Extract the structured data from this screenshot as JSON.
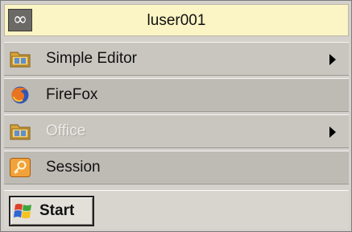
{
  "header": {
    "logo_glyph": "∞",
    "username": "luser001"
  },
  "menu": {
    "items": [
      {
        "label": "Simple Editor",
        "icon": "folder-icon",
        "has_submenu": true,
        "disabled": false
      },
      {
        "label": "FireFox",
        "icon": "firefox-icon",
        "has_submenu": false,
        "disabled": false
      },
      {
        "label": "Office",
        "icon": "folder-icon",
        "has_submenu": true,
        "disabled": true
      },
      {
        "label": "Session",
        "icon": "key-icon",
        "has_submenu": false,
        "disabled": false
      }
    ]
  },
  "taskbar": {
    "start_label": "Start",
    "start_icon": "windows-logo-icon"
  },
  "colors": {
    "header_bg": "#fbf4c4",
    "menu_bg": "#c9c6c0",
    "menu_bg_alt": "#bebbb5",
    "disabled_text": "#eceae6",
    "taskbar_bg": "#d8d5cf"
  }
}
